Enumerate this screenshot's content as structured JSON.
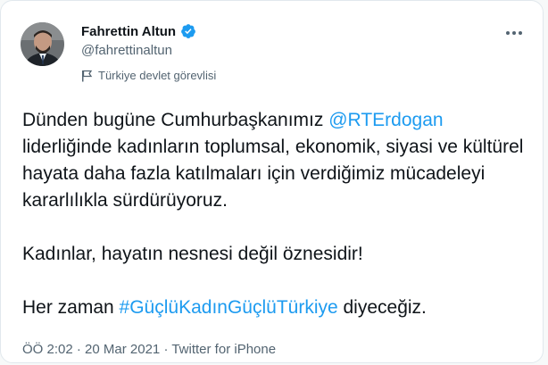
{
  "author": {
    "display_name": "Fahrettin Altun",
    "handle": "@fahrettinaltun",
    "label": "Türkiye devlet görevlisi"
  },
  "tweet": {
    "line1_before": "Dünden bugüne Cumhurbaşkanımız ",
    "mention": "@RTErdogan",
    "line1_after": "liderliğinde kadınların toplumsal, ekonomik, siyasi ve kültürel hayata daha fazla katılmaları için verdiğimiz mücadeleyi kararlılıkla sürdürüyoruz.",
    "paragraph2": "Kadınlar, hayatın nesnesi değil öznesidir!",
    "p3_before": "Her zaman ",
    "hashtag": "#GüçlüKadınGüçlüTürkiye",
    "p3_after": " diyeceğiz."
  },
  "meta": {
    "time": "ÖÖ 2:02",
    "sep1": " · ",
    "date": "20 Mar 2021",
    "sep2": " · ",
    "source": "Twitter for iPhone"
  },
  "colors": {
    "link": "#1d9bf0",
    "verified": "#1d9bf0",
    "text": "#0f1419",
    "secondary": "#536471"
  },
  "icons": [
    "avatar",
    "verified-badge-icon",
    "flag-icon",
    "more-options-icon"
  ]
}
